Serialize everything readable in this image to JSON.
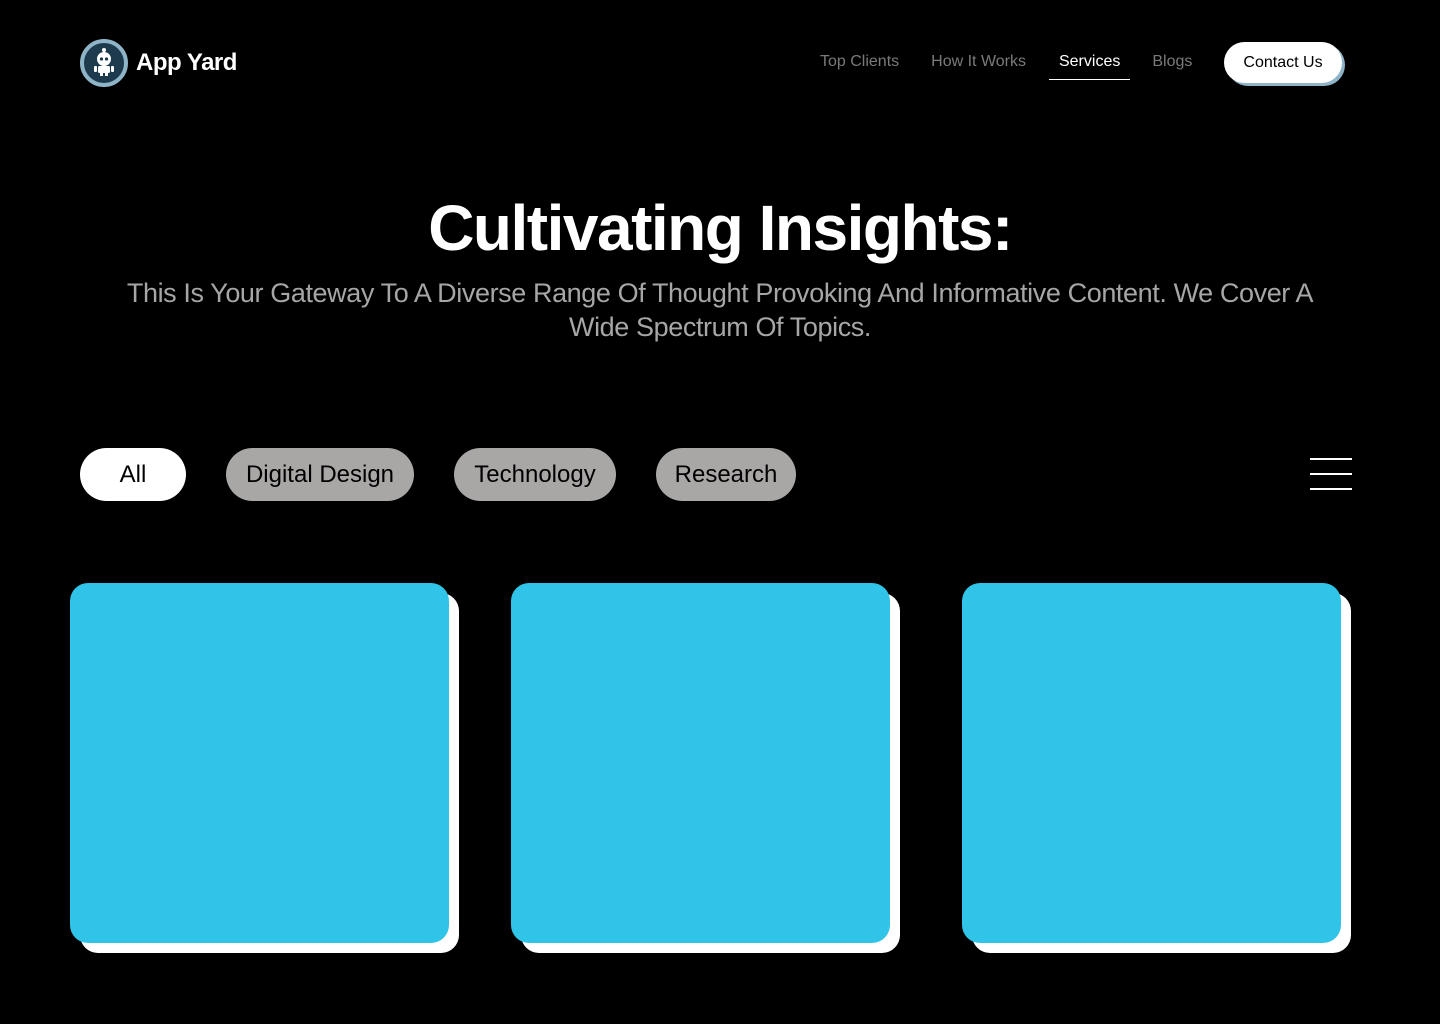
{
  "brand": {
    "name": "App Yard",
    "logo_icon": "robot-icon"
  },
  "nav": {
    "items": [
      {
        "label": "Top Clients",
        "active": false
      },
      {
        "label": "How It Works",
        "active": false
      },
      {
        "label": "Services",
        "active": true
      },
      {
        "label": "Blogs",
        "active": false
      }
    ],
    "contact_label": "Contact Us"
  },
  "hero": {
    "title": "Cultivating Insights:",
    "subtitle": "This Is Your Gateway To A Diverse Range Of Thought Provoking And Informative Content. We Cover A Wide Spectrum Of Topics."
  },
  "filters": {
    "items": [
      {
        "label": "All",
        "selected": true
      },
      {
        "label": "Digital Design",
        "selected": false
      },
      {
        "label": "Technology",
        "selected": false
      },
      {
        "label": "Research",
        "selected": false
      }
    ],
    "menu_icon": "hamburger-menu-icon"
  },
  "colors": {
    "background": "#000000",
    "card": "#2fc4e8",
    "card_shadow": "#ffffff",
    "filter_inactive": "#a9a6a6",
    "accent": "#8fb4c8"
  }
}
